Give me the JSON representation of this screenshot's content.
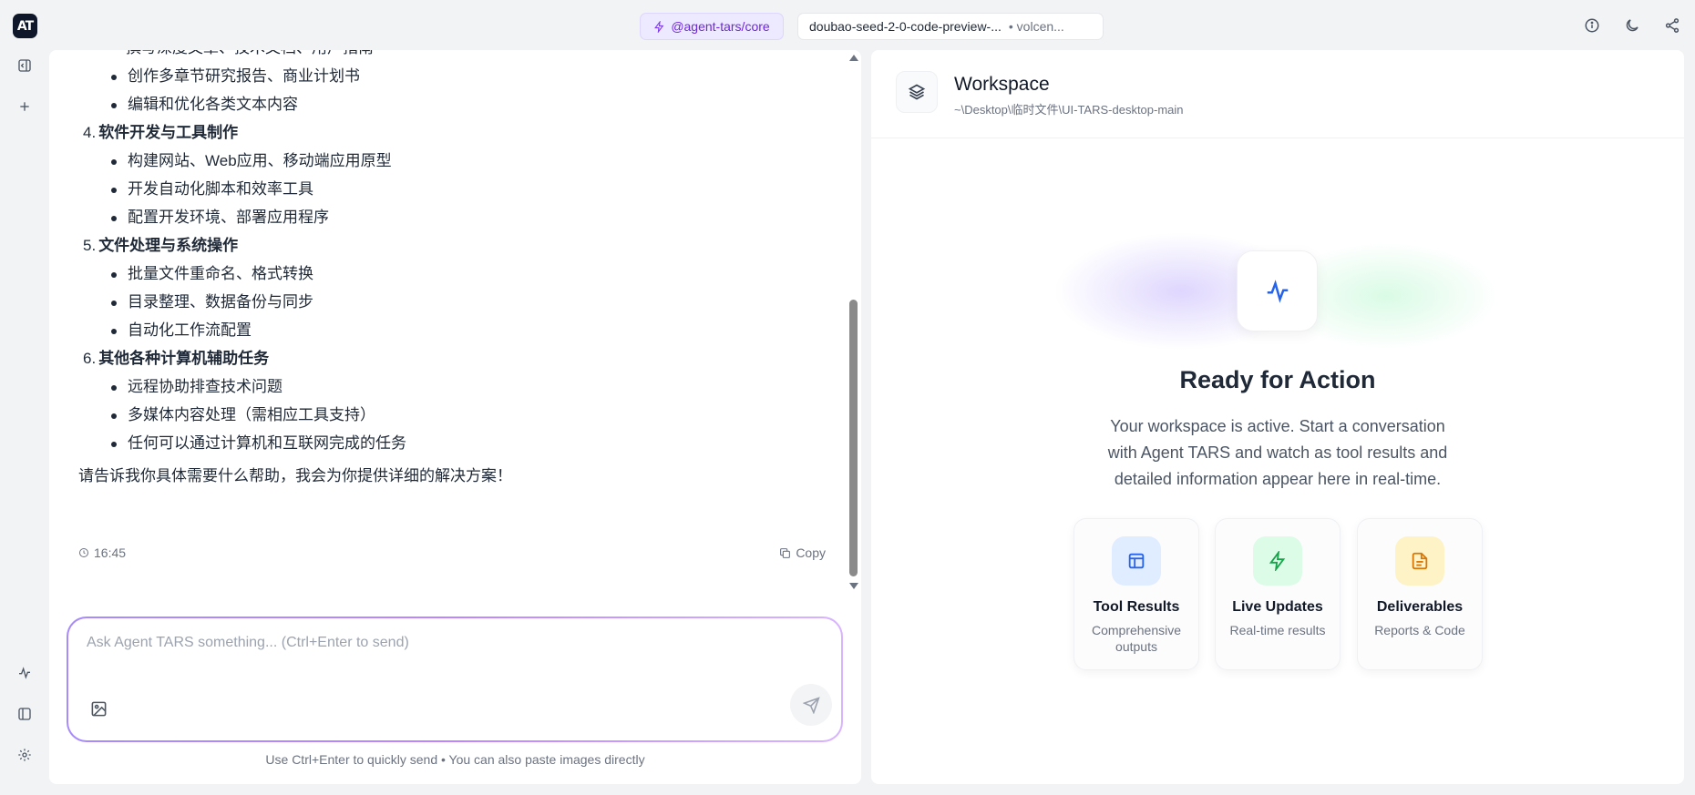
{
  "app": {
    "logo_text": "AT"
  },
  "header": {
    "agent_chip": "@agent-tars/core",
    "model_chip": {
      "name": "doubao-seed-2-0-code-preview-...",
      "provider": "• volcen..."
    }
  },
  "chat": {
    "partial_line": "撰写深度文章、技术文档、用户指南",
    "intro_items": [
      "创作多章节研究报告、商业计划书",
      "编辑和优化各类文本内容"
    ],
    "sections": [
      {
        "num": "4.",
        "title": "软件开发与工具制作",
        "items": [
          "构建网站、Web应用、移动端应用原型",
          "开发自动化脚本和效率工具",
          "配置开发环境、部署应用程序"
        ]
      },
      {
        "num": "5.",
        "title": "文件处理与系统操作",
        "items": [
          "批量文件重命名、格式转换",
          "目录整理、数据备份与同步",
          "自动化工作流配置"
        ]
      },
      {
        "num": "6.",
        "title": "其他各种计算机辅助任务",
        "items": [
          "远程协助排查技术问题",
          "多媒体内容处理（需相应工具支持）",
          "任何可以通过计算机和互联网完成的任务"
        ]
      }
    ],
    "closing": "请告诉我你具体需要什么帮助，我会为你提供详细的解决方案！",
    "timestamp": "16:45",
    "copy_label": "Copy",
    "input_placeholder": "Ask Agent TARS something... (Ctrl+Enter to send)",
    "hint": "Use Ctrl+Enter to quickly send • You can also paste images directly"
  },
  "workspace": {
    "title": "Workspace",
    "path": "~\\Desktop\\临时文件\\UI-TARS-desktop-main",
    "ready_title": "Ready for Action",
    "description": "Your workspace is active. Start a conversation with Agent TARS and watch as tool results and detailed information appear here in real-time.",
    "features": [
      {
        "title": "Tool Results",
        "subtitle": "Comprehensive outputs",
        "icon": "layout-icon",
        "color": "#2563eb",
        "bg": "#e0ecff"
      },
      {
        "title": "Live Updates",
        "subtitle": "Real-time results",
        "icon": "lightning-icon",
        "color": "#16a34a",
        "bg": "#dcfce7"
      },
      {
        "title": "Deliverables",
        "subtitle": "Reports & Code",
        "icon": "document-icon",
        "color": "#d97706",
        "bg": "#fef3c7"
      }
    ]
  }
}
